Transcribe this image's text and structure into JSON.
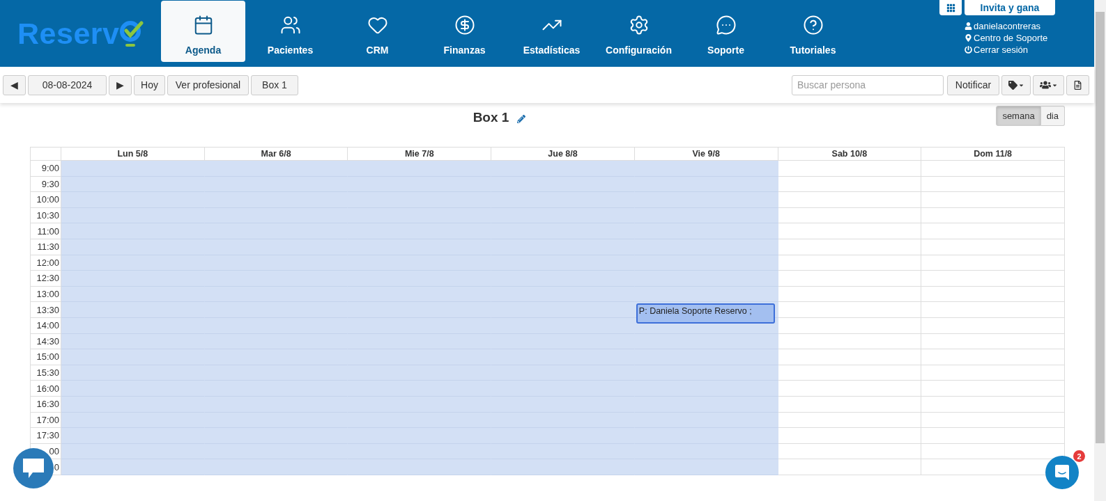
{
  "logo": {
    "text": "Reserv"
  },
  "nav": [
    {
      "label": "Agenda",
      "selected": true
    },
    {
      "label": "Pacientes",
      "selected": false
    },
    {
      "label": "CRM",
      "selected": false
    },
    {
      "label": "Finanzas",
      "selected": false
    },
    {
      "label": "Estadísticas",
      "selected": false
    },
    {
      "label": "Configuración",
      "selected": false
    },
    {
      "label": "Soporte",
      "selected": false
    },
    {
      "label": "Tutoriales",
      "selected": false
    }
  ],
  "account": {
    "invite": "Invita y gana",
    "username": "danielacontreras",
    "support": "Centro de Soporte",
    "logout": "Cerrar sesión"
  },
  "toolbar": {
    "prev": "◀",
    "date": "08-08-2024",
    "next": "▶",
    "today": "Hoy",
    "professional": "Ver profesional",
    "box": "Box 1",
    "search_placeholder": "Buscar persona",
    "notify": "Notificar"
  },
  "calendar": {
    "title": "Box 1",
    "views": [
      {
        "label": "semana",
        "selected": true
      },
      {
        "label": "dia",
        "selected": false
      }
    ],
    "days": [
      {
        "label": "Lun 5/8",
        "available": true
      },
      {
        "label": "Mar 6/8",
        "available": true
      },
      {
        "label": "Mie 7/8",
        "available": true
      },
      {
        "label": "Jue 8/8",
        "available": true
      },
      {
        "label": "Vie 9/8",
        "available": true
      },
      {
        "label": "Sab 10/8",
        "available": false
      },
      {
        "label": "Dom 11/8",
        "available": false
      }
    ],
    "rows": [
      {
        "time": "9:00"
      },
      {
        "time": "9:30"
      },
      {
        "time": "10:00"
      },
      {
        "time": "10:30"
      },
      {
        "time": "11:00"
      },
      {
        "time": "11:30"
      },
      {
        "time": "12:00"
      },
      {
        "time": "12:30"
      },
      {
        "time": "13:00"
      },
      {
        "time": "13:30",
        "cells": [
          {
            "kind": "free"
          },
          {
            "kind": "free"
          },
          {
            "kind": "free"
          },
          {
            "kind": "free"
          },
          {
            "kind": "appointment",
            "text": "P: Daniela Soporte Reservo ;"
          },
          {
            "kind": "free"
          },
          {
            "kind": "free"
          }
        ]
      },
      {
        "time": "14:00"
      },
      {
        "time": "14:30"
      },
      {
        "time": "15:00"
      },
      {
        "time": "15:30"
      },
      {
        "time": "16:00"
      },
      {
        "time": "16:30"
      },
      {
        "time": "17:00"
      },
      {
        "time": "17:30"
      },
      {
        "time": "00"
      },
      {
        "time": "0"
      }
    ]
  },
  "messenger": {
    "badge": "2"
  }
}
